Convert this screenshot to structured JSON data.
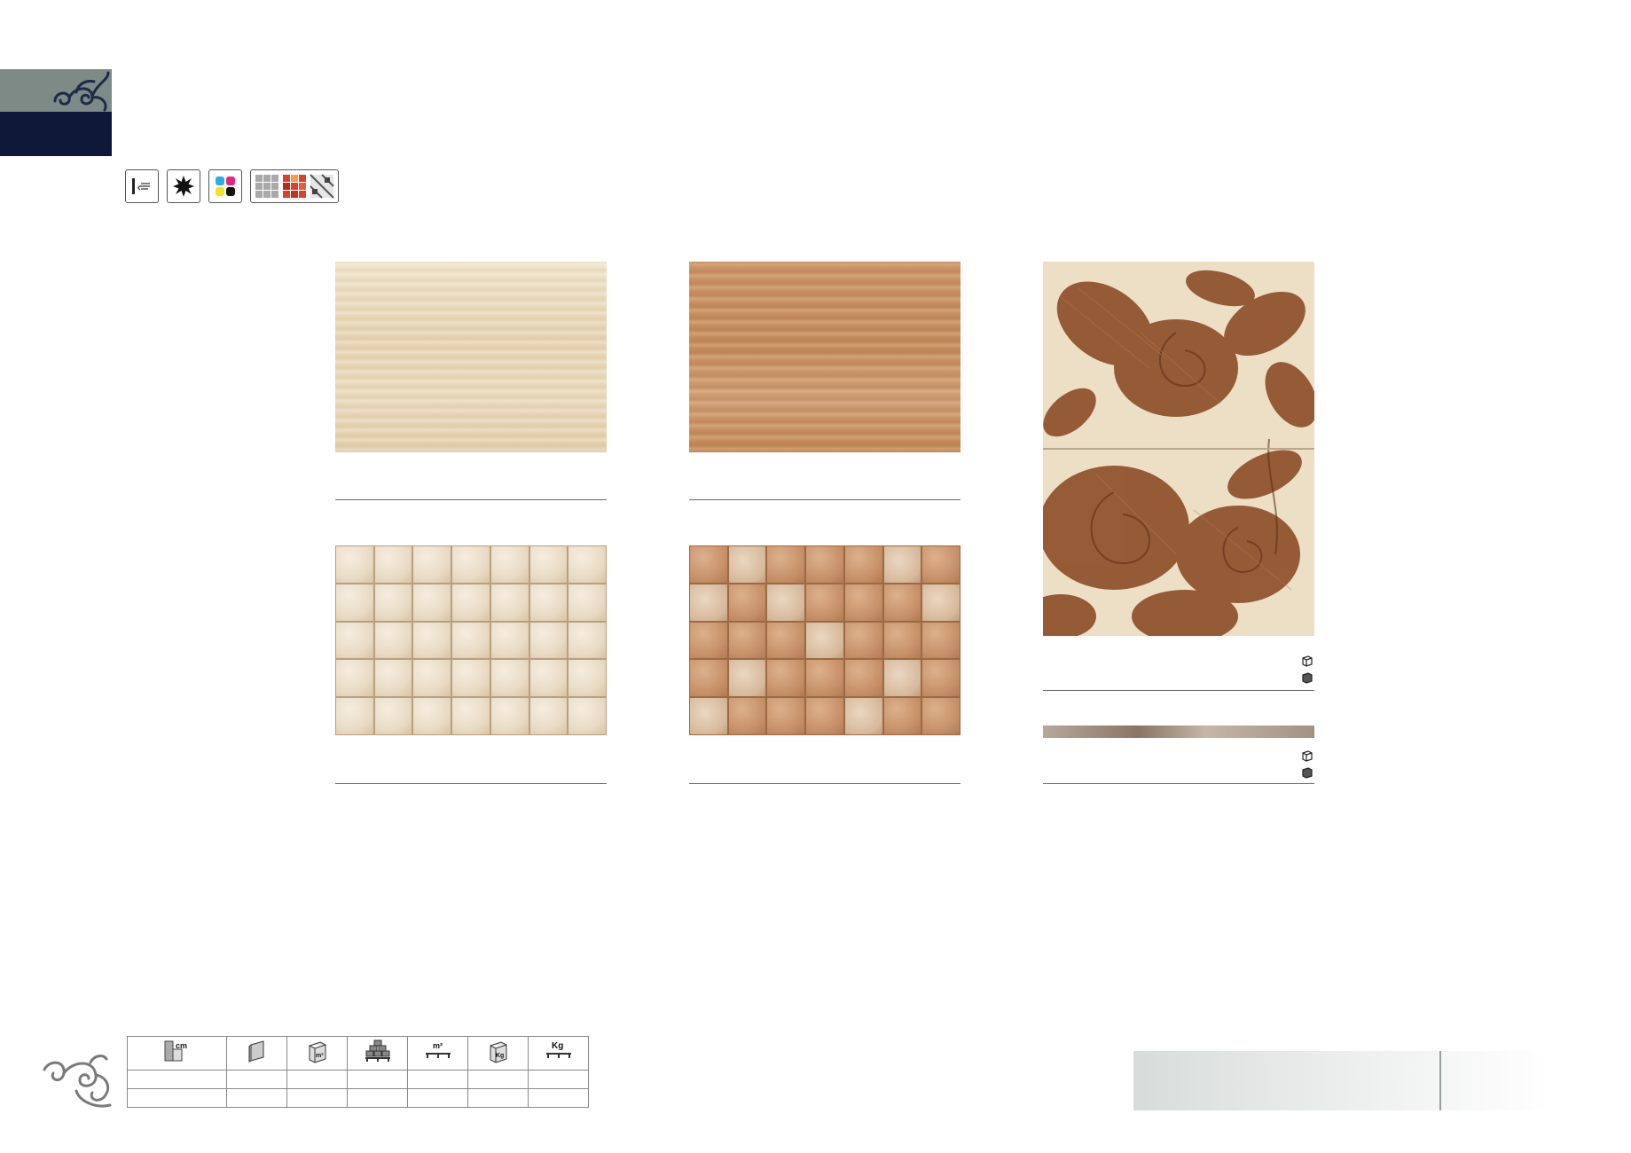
{
  "feature_icons": [
    {
      "name": "wall-tile-icon"
    },
    {
      "name": "frost-resistant-icon"
    },
    {
      "name": "color-variation-icon"
    },
    {
      "name": "pattern-options-icon"
    }
  ],
  "spec_table": {
    "header_icons": [
      "size-cm-icon",
      "tile-piece-icon",
      "box-m2-icon",
      "pallet-boxes-icon",
      "pallet-m2-icon",
      "box-kg-icon",
      "pallet-kg-icon"
    ],
    "header_labels": [
      "cm",
      "",
      "m²",
      "",
      "m²",
      "Kg",
      "Kg"
    ],
    "rows": [
      [
        "",
        "",
        "",
        "",
        "",
        "",
        ""
      ],
      [
        "",
        "",
        "",
        "",
        "",
        "",
        ""
      ]
    ]
  },
  "colors": {
    "corner_top": "#7e8a86",
    "corner_bottom": "#0e1838",
    "ornament": "#1d2a4a"
  }
}
